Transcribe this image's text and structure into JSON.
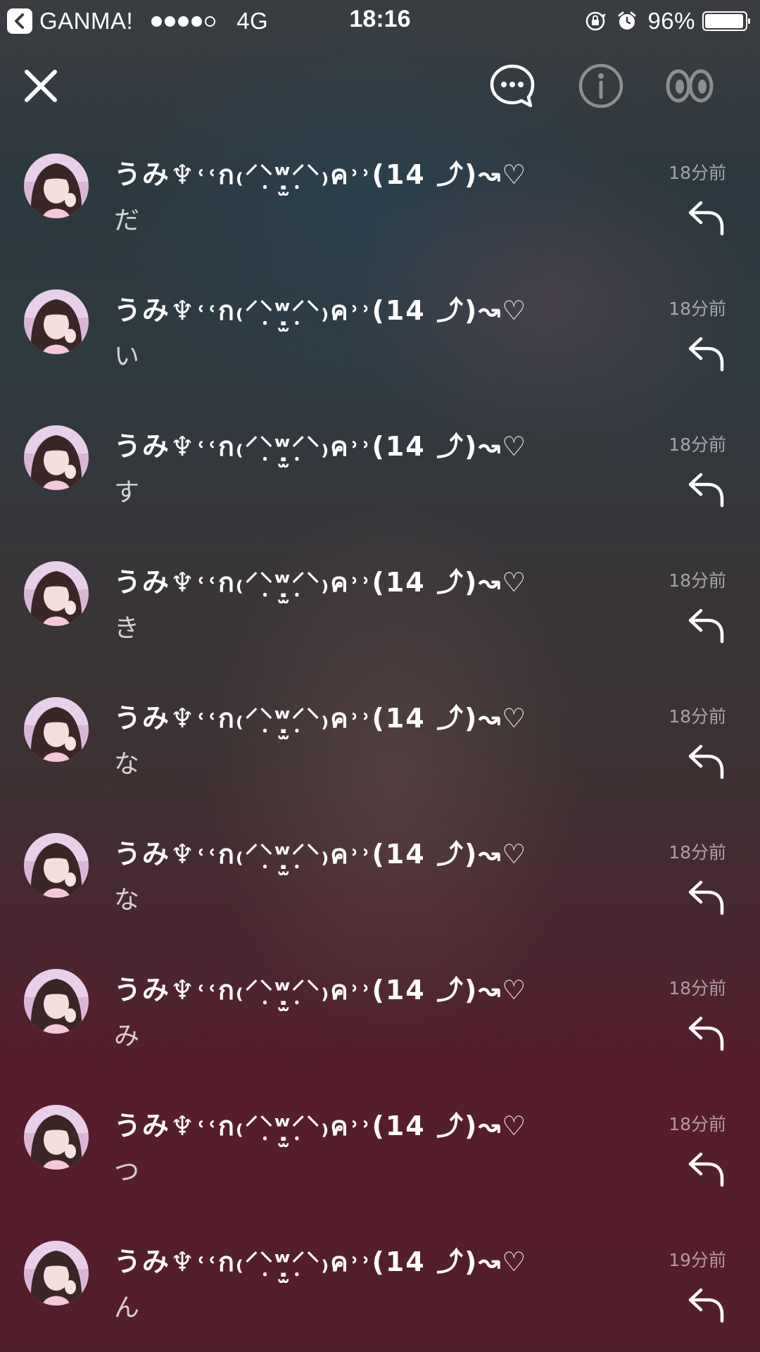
{
  "status_bar": {
    "back_app": "GANMA!",
    "signal_bars": 4,
    "network": "4G",
    "time": "18:16",
    "battery_text": "96%",
    "battery_level": 0.96,
    "icons": [
      "orientation-lock-icon",
      "alarm-icon"
    ]
  },
  "toolbar": {
    "close_icon": "close-icon",
    "comments_icon": "speech-bubble-icon",
    "info_icon": "info-icon",
    "eyes_icon": "eyes-icon"
  },
  "colors": {
    "text": "#ffffff",
    "muted": "#9a9a9a",
    "bg_top": "#3b3d40",
    "bg_bottom": "#521f2c"
  },
  "comments": [
    {
      "user": "うみ♆˓˓ก₍⸍⸌̣ʷ̣̫⸍̣⸌₎ค˒˒(14 ⤴︎)↝♡",
      "message": "だ",
      "time": "18分前"
    },
    {
      "user": "うみ♆˓˓ก₍⸍⸌̣ʷ̣̫⸍̣⸌₎ค˒˒(14 ⤴︎)↝♡",
      "message": "い",
      "time": "18分前"
    },
    {
      "user": "うみ♆˓˓ก₍⸍⸌̣ʷ̣̫⸍̣⸌₎ค˒˒(14 ⤴︎)↝♡",
      "message": "す",
      "time": "18分前"
    },
    {
      "user": "うみ♆˓˓ก₍⸍⸌̣ʷ̣̫⸍̣⸌₎ค˒˒(14 ⤴︎)↝♡",
      "message": "き",
      "time": "18分前"
    },
    {
      "user": "うみ♆˓˓ก₍⸍⸌̣ʷ̣̫⸍̣⸌₎ค˒˒(14 ⤴︎)↝♡",
      "message": "な",
      "time": "18分前"
    },
    {
      "user": "うみ♆˓˓ก₍⸍⸌̣ʷ̣̫⸍̣⸌₎ค˒˒(14 ⤴︎)↝♡",
      "message": "な",
      "time": "18分前"
    },
    {
      "user": "うみ♆˓˓ก₍⸍⸌̣ʷ̣̫⸍̣⸌₎ค˒˒(14 ⤴︎)↝♡",
      "message": "み",
      "time": "18分前"
    },
    {
      "user": "うみ♆˓˓ก₍⸍⸌̣ʷ̣̫⸍̣⸌₎ค˒˒(14 ⤴︎)↝♡",
      "message": "つ",
      "time": "18分前"
    },
    {
      "user": "うみ♆˓˓ก₍⸍⸌̣ʷ̣̫⸍̣⸌₎ค˒˒(14 ⤴︎)↝♡",
      "message": "ん",
      "time": "19分前"
    }
  ]
}
